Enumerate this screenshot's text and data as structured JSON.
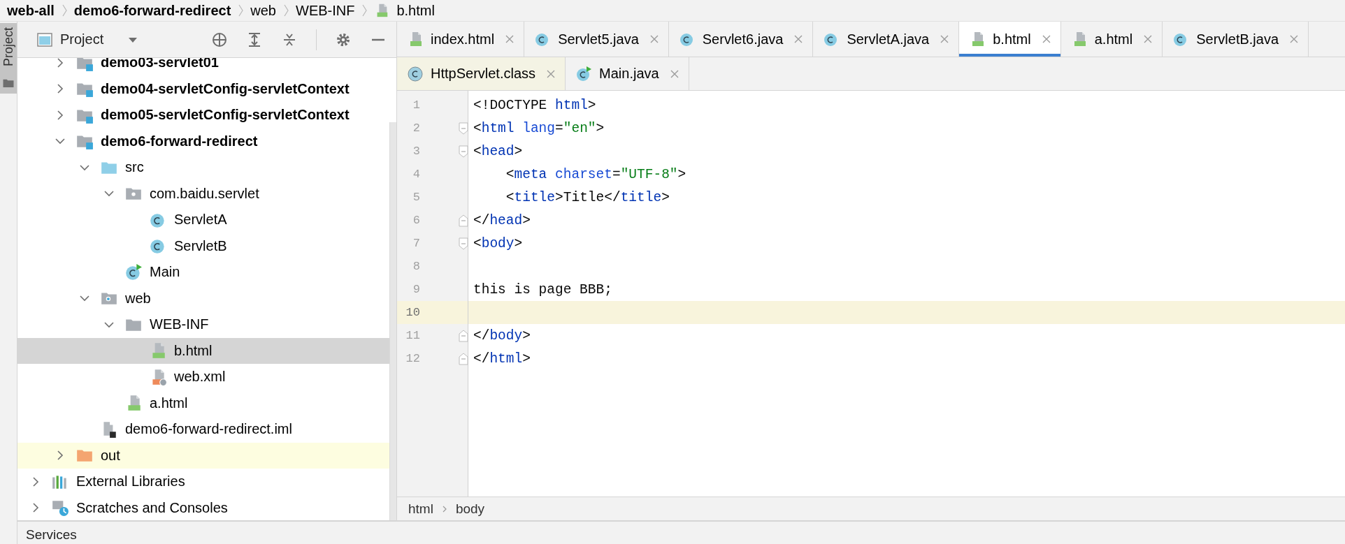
{
  "breadcrumb": [
    {
      "label": "web-all",
      "bold": true
    },
    {
      "label": "demo6-forward-redirect",
      "bold": true
    },
    {
      "label": "web",
      "bold": false
    },
    {
      "label": "WEB-INF",
      "bold": false
    },
    {
      "label": "b.html",
      "bold": false,
      "kind": "html"
    }
  ],
  "side_stripe": {
    "label": "Project",
    "selected": true
  },
  "project_panel": {
    "title": "Project",
    "tree": [
      {
        "label": "demo03-servlet01",
        "kind": "module",
        "bold": true,
        "expanded": false,
        "selected": false,
        "highlighted": false
      },
      {
        "label": "demo04-servletConfig-servletContext",
        "kind": "module",
        "bold": true,
        "expanded": false,
        "selected": false,
        "highlighted": false
      },
      {
        "label": "demo05-servletConfig-servletContext",
        "kind": "module",
        "bold": true,
        "expanded": false,
        "selected": false,
        "highlighted": false
      },
      {
        "label": "demo6-forward-redirect",
        "kind": "module",
        "bold": true,
        "expanded": true,
        "selected": false,
        "highlighted": false,
        "children": [
          {
            "label": "src",
            "kind": "source-folder",
            "bold": false,
            "expanded": true,
            "selected": false,
            "highlighted": false,
            "children": [
              {
                "label": "com.baidu.servlet",
                "kind": "package",
                "bold": false,
                "expanded": true,
                "selected": false,
                "highlighted": false,
                "children": [
                  {
                    "label": "ServletA",
                    "kind": "class",
                    "bold": false,
                    "selected": false,
                    "highlighted": false
                  },
                  {
                    "label": "ServletB",
                    "kind": "class",
                    "bold": false,
                    "selected": false,
                    "highlighted": false
                  }
                ]
              },
              {
                "label": "Main",
                "kind": "main-class",
                "bold": false,
                "selected": false,
                "highlighted": false
              }
            ]
          },
          {
            "label": "web",
            "kind": "web-folder",
            "bold": false,
            "expanded": true,
            "selected": false,
            "highlighted": false,
            "children": [
              {
                "label": "WEB-INF",
                "kind": "folder",
                "bold": false,
                "expanded": true,
                "selected": false,
                "highlighted": false,
                "children": [
                  {
                    "label": "b.html",
                    "kind": "html",
                    "bold": false,
                    "selected": true,
                    "highlighted": false
                  },
                  {
                    "label": "web.xml",
                    "kind": "xml",
                    "bold": false,
                    "selected": false,
                    "highlighted": false
                  }
                ]
              },
              {
                "label": "a.html",
                "kind": "html",
                "bold": false,
                "selected": false,
                "highlighted": false
              }
            ]
          },
          {
            "label": "demo6-forward-redirect.iml",
            "kind": "iml",
            "bold": false,
            "selected": false,
            "highlighted": false
          }
        ]
      },
      {
        "label": "out",
        "kind": "excluded-folder",
        "bold": false,
        "expanded": false,
        "selected": false,
        "highlighted": true
      }
    ],
    "root_items": [
      {
        "label": "External Libraries",
        "kind": "libraries",
        "bold": false,
        "expanded": false,
        "selected": false,
        "highlighted": false
      },
      {
        "label": "Scratches and Consoles",
        "kind": "scratches",
        "bold": false,
        "expanded": false,
        "selected": false,
        "highlighted": false
      }
    ]
  },
  "editor": {
    "tab_rows": [
      [
        {
          "label": "index.html",
          "kind": "html",
          "selected": false
        },
        {
          "label": "Servlet5.java",
          "kind": "class",
          "selected": false
        },
        {
          "label": "Servlet6.java",
          "kind": "class",
          "selected": false
        },
        {
          "label": "ServletA.java",
          "kind": "class",
          "selected": false
        },
        {
          "label": "b.html",
          "kind": "html",
          "selected": true
        },
        {
          "label": "a.html",
          "kind": "html",
          "selected": false
        },
        {
          "label": "ServletB.java",
          "kind": "class",
          "selected": false
        }
      ],
      [
        {
          "label": "HttpServlet.class",
          "kind": "library-class",
          "selected": false
        },
        {
          "label": "Main.java",
          "kind": "main-class",
          "selected": false
        }
      ]
    ],
    "lines": [
      {
        "number": "1",
        "current": false,
        "fold_open": false,
        "fold_close": false,
        "tokens": [
          {
            "text": "<!DOCTYPE ",
            "kind": "plain"
          },
          {
            "text": "html",
            "kind": "tag"
          },
          {
            "text": ">",
            "kind": "plain"
          }
        ]
      },
      {
        "number": "2",
        "current": false,
        "fold_open": true,
        "fold_close": false,
        "tokens": [
          {
            "text": "<",
            "kind": "plain"
          },
          {
            "text": "html ",
            "kind": "tag"
          },
          {
            "text": "lang",
            "kind": "attr"
          },
          {
            "text": "=",
            "kind": "plain"
          },
          {
            "text": "\"en\"",
            "kind": "string"
          },
          {
            "text": ">",
            "kind": "plain"
          }
        ]
      },
      {
        "number": "3",
        "current": false,
        "fold_open": true,
        "fold_close": false,
        "tokens": [
          {
            "text": "<",
            "kind": "plain"
          },
          {
            "text": "head",
            "kind": "tag"
          },
          {
            "text": ">",
            "kind": "plain"
          }
        ]
      },
      {
        "number": "4",
        "current": false,
        "fold_open": false,
        "fold_close": false,
        "tokens": [
          {
            "text": "    <",
            "kind": "plain"
          },
          {
            "text": "meta ",
            "kind": "tag"
          },
          {
            "text": "charset",
            "kind": "attr"
          },
          {
            "text": "=",
            "kind": "plain"
          },
          {
            "text": "\"UTF-8\"",
            "kind": "string"
          },
          {
            "text": ">",
            "kind": "plain"
          }
        ]
      },
      {
        "number": "5",
        "current": false,
        "fold_open": false,
        "fold_close": false,
        "tokens": [
          {
            "text": "    <",
            "kind": "plain"
          },
          {
            "text": "title",
            "kind": "tag"
          },
          {
            "text": ">Title</",
            "kind": "plain"
          },
          {
            "text": "title",
            "kind": "tag"
          },
          {
            "text": ">",
            "kind": "plain"
          }
        ]
      },
      {
        "number": "6",
        "current": false,
        "fold_open": false,
        "fold_close": true,
        "tokens": [
          {
            "text": "</",
            "kind": "plain"
          },
          {
            "text": "head",
            "kind": "tag"
          },
          {
            "text": ">",
            "kind": "plain"
          }
        ]
      },
      {
        "number": "7",
        "current": false,
        "fold_open": true,
        "fold_close": false,
        "tokens": [
          {
            "text": "<",
            "kind": "plain"
          },
          {
            "text": "body",
            "kind": "tag"
          },
          {
            "text": ">",
            "kind": "plain"
          }
        ]
      },
      {
        "number": "8",
        "current": false,
        "fold_open": false,
        "fold_close": false
      },
      {
        "number": "9",
        "current": false,
        "fold_open": false,
        "fold_close": false,
        "tokens": [
          {
            "text": "this is page BBB;",
            "kind": "plain"
          }
        ]
      },
      {
        "number": "10",
        "current": true,
        "fold_open": false,
        "fold_close": false
      },
      {
        "number": "11",
        "current": false,
        "fold_open": false,
        "fold_close": true,
        "tokens": [
          {
            "text": "</",
            "kind": "plain"
          },
          {
            "text": "body",
            "kind": "tag"
          },
          {
            "text": ">",
            "kind": "plain"
          }
        ]
      },
      {
        "number": "12",
        "current": false,
        "fold_open": false,
        "fold_close": true,
        "tokens": [
          {
            "text": "</",
            "kind": "plain"
          },
          {
            "text": "html",
            "kind": "tag"
          },
          {
            "text": ">",
            "kind": "plain"
          }
        ]
      }
    ],
    "breadcrumb": [
      "html",
      "body"
    ]
  },
  "services_bar": {
    "title": "Services"
  }
}
